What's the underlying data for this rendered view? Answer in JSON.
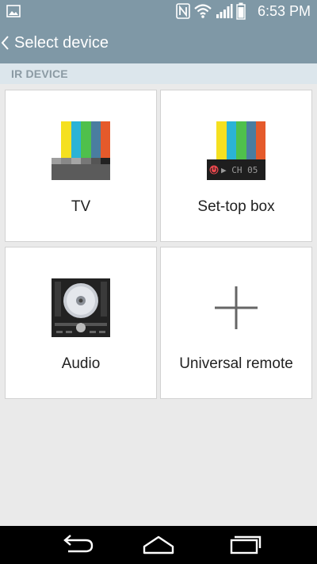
{
  "status_bar": {
    "time": "6:53 PM",
    "icons": [
      "gallery-icon",
      "nfc-icon",
      "wifi-icon",
      "signal-icon",
      "battery-icon"
    ]
  },
  "app_bar": {
    "back_icon": "chevron-left-icon",
    "title": "Select device"
  },
  "section": {
    "header": "IR DEVICE"
  },
  "devices": [
    {
      "label": "TV",
      "icon": "tv-icon"
    },
    {
      "label": "Set-top box",
      "icon": "set-top-box-icon",
      "channel_text": "▶ CH 05"
    },
    {
      "label": "Audio",
      "icon": "audio-icon"
    },
    {
      "label": "Universal remote",
      "icon": "plus-icon"
    }
  ],
  "nav_bar": {
    "buttons": [
      "back-nav-icon",
      "home-nav-icon",
      "recents-nav-icon"
    ]
  },
  "colors": {
    "app_bar": "#7f98a6",
    "section_header_bg": "#dce6ec",
    "section_header_text": "#8b9aa3",
    "background": "#eaeaea"
  }
}
